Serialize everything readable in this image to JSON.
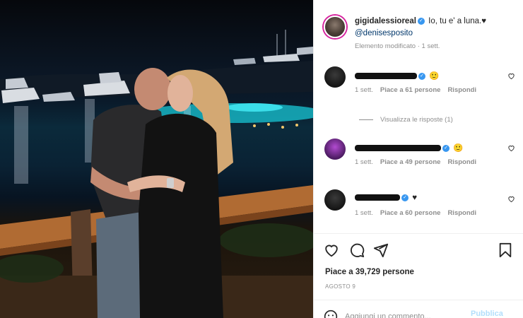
{
  "post": {
    "username": "gigidalessioreal",
    "caption": "Io, tu e' a luna.♥",
    "mention": "@denisesposito",
    "edited_label": "Elemento modificato",
    "age": "1 sett.",
    "likes_label": "Piace a 39,729 persone",
    "date": "AGOSTO 9"
  },
  "comments": [
    {
      "text_tail": "🙂",
      "age": "1 sett.",
      "likes": "Piace a 61 persone",
      "reply": "Rispondi",
      "avatar": "dark"
    },
    {
      "text_tail": "🙂",
      "age": "1 sett.",
      "likes": "Piace a 49 persone",
      "reply": "Rispondi",
      "avatar": "purple"
    },
    {
      "text_tail": "♥",
      "age": "1 sett.",
      "likes": "Piace a 60 persone",
      "reply": "Rispondi",
      "avatar": "dark"
    }
  ],
  "view_replies": "Visualizza le risposte (1)",
  "add_comment_placeholder": "Aggiungi un commento...",
  "publish_label": "Pubblica",
  "icons": [
    "heart-icon",
    "comment-icon",
    "share-icon",
    "bookmark-icon",
    "emoji-icon",
    "verified-icon"
  ],
  "colors": {
    "verified": "#3897f0",
    "mention": "#00376b",
    "publish_disabled": "#b2dffc",
    "meta": "#8e8e8e"
  }
}
